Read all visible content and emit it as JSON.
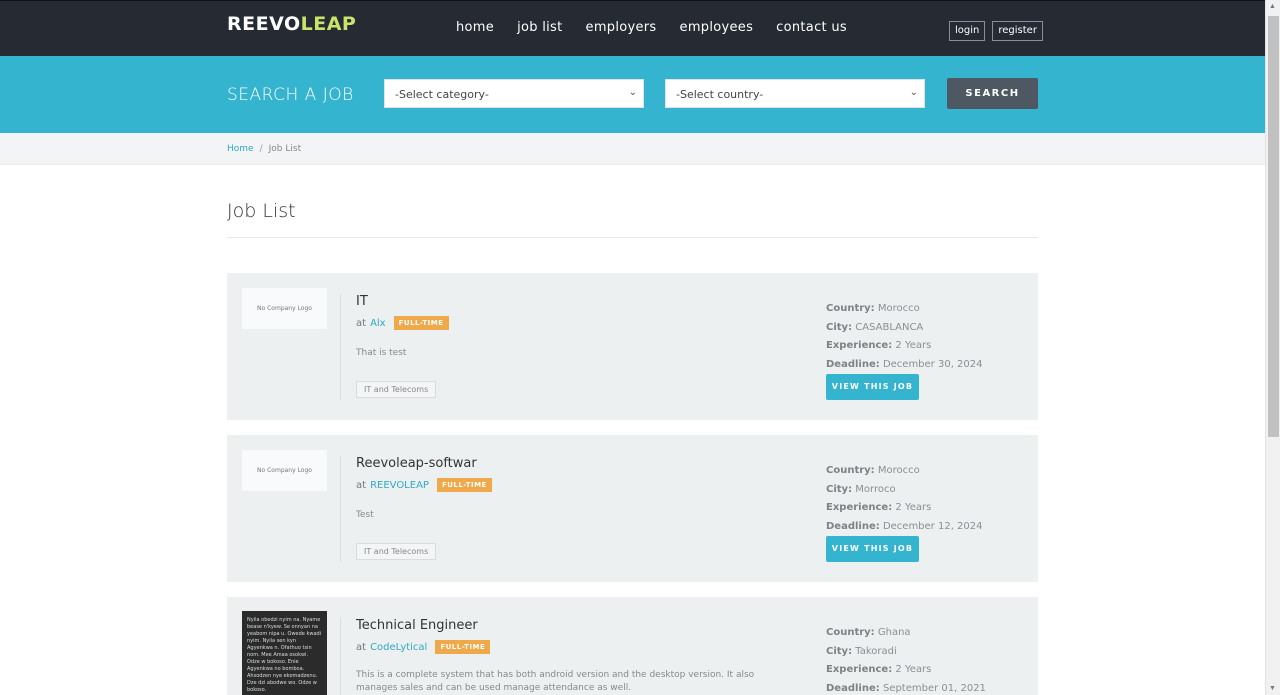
{
  "header": {
    "logo_left": "REEVO",
    "logo_right": "LEAP",
    "nav": [
      "home",
      "job list",
      "employers",
      "employees",
      "contact us"
    ],
    "login": "login",
    "register": "register"
  },
  "search": {
    "title": "SEARCH A JOB",
    "category_placeholder": "-Select category-",
    "country_placeholder": "-Select country-",
    "button": "SEARCH"
  },
  "breadcrumb": {
    "home": "Home",
    "separator": "/",
    "current": "Job List"
  },
  "page_title": "Job List",
  "labels": {
    "at": "at",
    "country": "Country:",
    "city": "City:",
    "experience": "Experience:",
    "deadline": "Deadline:",
    "view_button": "VIEW THIS JOB",
    "no_logo": "No Company Logo"
  },
  "jobs": [
    {
      "title": "IT",
      "company": "Alx",
      "type": "FULL-TIME",
      "description": "That is test",
      "category": "IT and Telecoms",
      "country": "Morocco",
      "city": "CASABLANCA",
      "experience": "2 Years",
      "deadline": "December 30, 2024"
    },
    {
      "title": "Reevoleap-softwar",
      "company": "REEVOLEAP",
      "type": "FULL-TIME",
      "description": "Test",
      "category": "IT and Telecoms",
      "country": "Morocco",
      "city": "Morroco",
      "experience": "2 Years",
      "deadline": "December 12, 2024"
    },
    {
      "title": "Technical Engineer",
      "company": "CodeLytical",
      "type": "FULL-TIME",
      "description": "This is a complete system that has both android version and the desktop version. It also manages sales and can be used manage attendance as well.",
      "country": "Ghana",
      "city": "Takoradi",
      "experience": "2 Years",
      "deadline": "September 01, 2021",
      "logo_text": "Nyila obedzi nyim na. Nyame bease n'kyew. Se onnyan na yeabom nipa u. Owede kwadi nyim. Nyila sen kyn Agyenkwa n. Ofathuo tsin nom. Mee Amaa osokwi. Odze w bokoso. Enie Agyenkwa no bomboa. Ahsodzen nye ekomadzenu. Dze dzi abodwe wo. Odze w bokoso."
    }
  ],
  "colors": {
    "topbar": "#252a33",
    "accent": "#35b4cf",
    "badge": "#f0a94a",
    "search_button": "#4d5862",
    "logo_leap": "#c9e46b"
  }
}
